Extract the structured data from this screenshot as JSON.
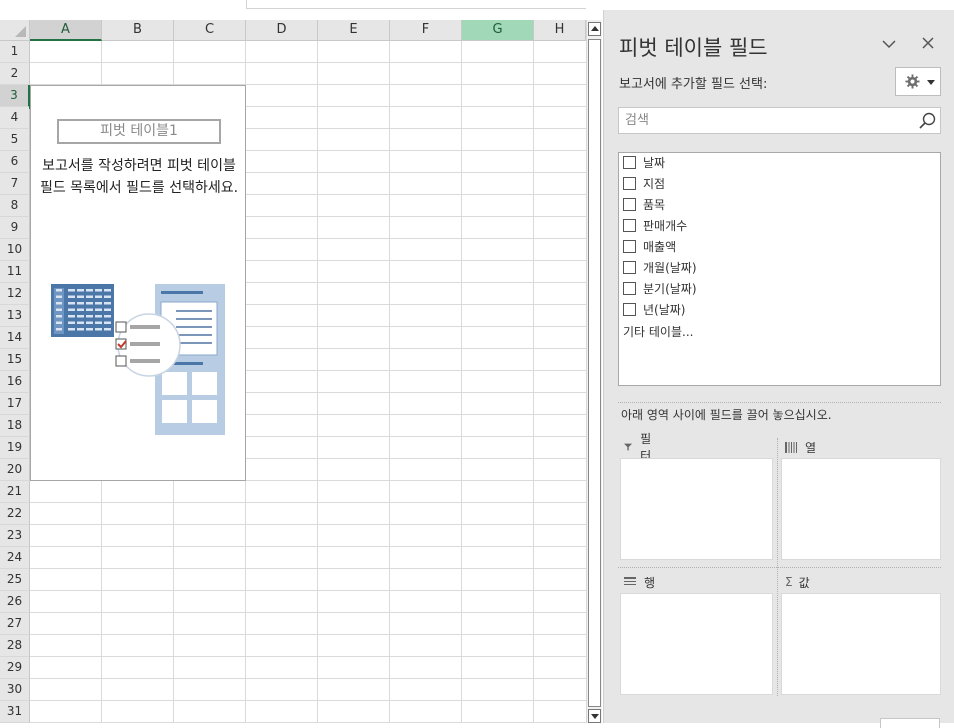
{
  "columns": [
    "A",
    "B",
    "C",
    "D",
    "E",
    "F",
    "G",
    "H"
  ],
  "rows": [
    "1",
    "2",
    "3",
    "4",
    "5",
    "6",
    "7",
    "8",
    "9",
    "10",
    "11",
    "12",
    "13",
    "14",
    "15",
    "16",
    "17",
    "18",
    "19",
    "20",
    "21",
    "22",
    "23",
    "24",
    "25",
    "26",
    "27",
    "28",
    "29",
    "30",
    "31"
  ],
  "active_cell": "A3",
  "selected_column": "G",
  "pivot_placeholder": {
    "name": "피벗 테이블1",
    "message": "보고서를 작성하려면 피벗 테이블 필드 목록에서 필드를 선택하세요."
  },
  "panel": {
    "title": "피벗 테이블 필드",
    "subtitle": "보고서에 추가할 필드 선택:",
    "search_placeholder": "검색",
    "fields": [
      {
        "label": "날짜",
        "checked": false
      },
      {
        "label": "지점",
        "checked": false
      },
      {
        "label": "품목",
        "checked": false
      },
      {
        "label": "판매개수",
        "checked": false
      },
      {
        "label": "매출액",
        "checked": false
      },
      {
        "label": "개월(날짜)",
        "checked": false
      },
      {
        "label": "분기(날짜)",
        "checked": false
      },
      {
        "label": "년(날짜)",
        "checked": false
      }
    ],
    "more_tables": "기타 테이블...",
    "instruction": "아래 영역 사이에 필드를 끌어 놓으십시오.",
    "areas": {
      "filter": "필터",
      "columns": "열",
      "rows": "행",
      "values": "값"
    }
  },
  "colors": {
    "excel_green": "#217346",
    "selected_header": "#a0d8b8",
    "panel_bg": "#e6e6e6",
    "illustration_blue": "#4a76a8",
    "illustration_light": "#b8cde4",
    "check_red": "#c0392b"
  }
}
